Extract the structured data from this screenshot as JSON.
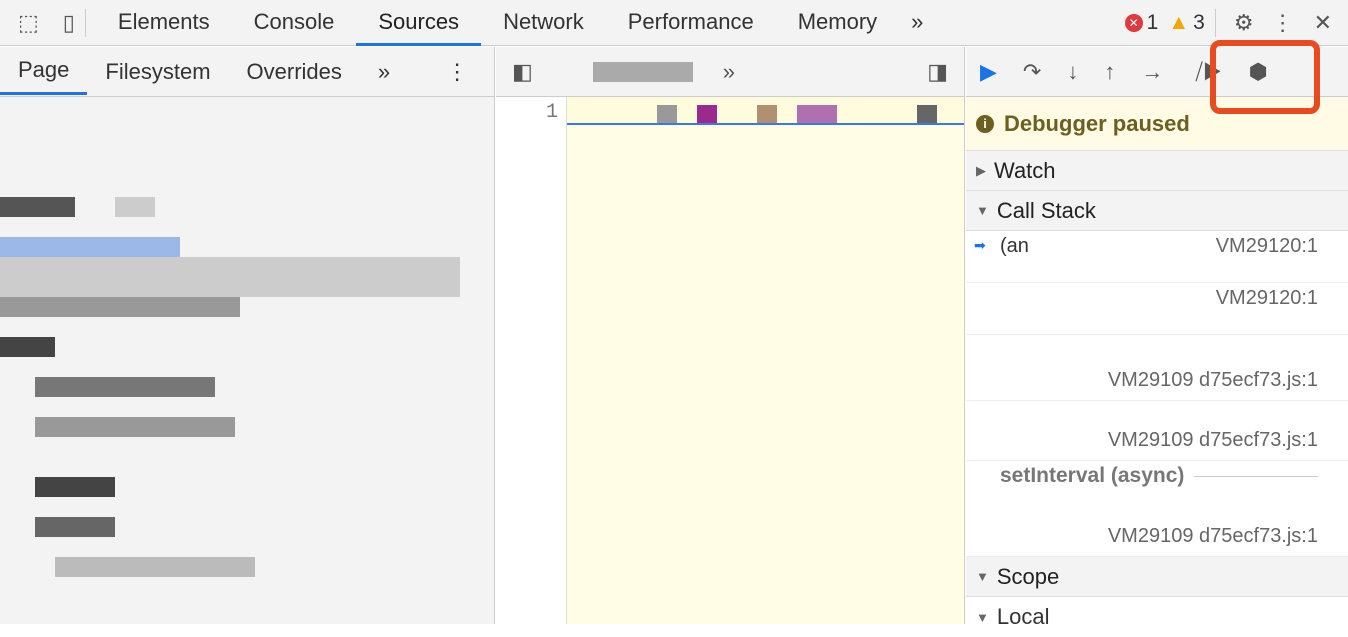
{
  "toolbar": {
    "tabs": [
      "Elements",
      "Console",
      "Sources",
      "Network",
      "Performance",
      "Memory"
    ],
    "active_tab": "Sources",
    "more": "»",
    "errors": "1",
    "warnings": "3",
    "icons": [
      "inspect-icon",
      "device-toggle-icon",
      "settings-icon",
      "more-vert-icon",
      "close-icon"
    ]
  },
  "navigator": {
    "tabs": [
      "Page",
      "Filesystem",
      "Overrides"
    ],
    "more": "»"
  },
  "editor": {
    "more": "»",
    "line_number": "1"
  },
  "debugger": {
    "paused_text": "Debugger paused",
    "highlight_color": "#ea4a1f",
    "sections": {
      "watch": "Watch",
      "call_stack": "Call Stack",
      "scope": "Scope",
      "local": "Local"
    },
    "frames": [
      {
        "fn": "(an",
        "loc": "VM29120:1"
      },
      {
        "fn": "",
        "loc": "VM29120:1"
      },
      {
        "fn": "",
        "loc": "VM29109 d75ecf73.js:1"
      },
      {
        "fn": "",
        "loc": "VM29109 d75ecf73.js:1"
      }
    ],
    "async_label": "setInterval (async)",
    "async_frames": [
      {
        "fn": "",
        "loc": "VM29109 d75ecf73.js:1"
      }
    ]
  }
}
